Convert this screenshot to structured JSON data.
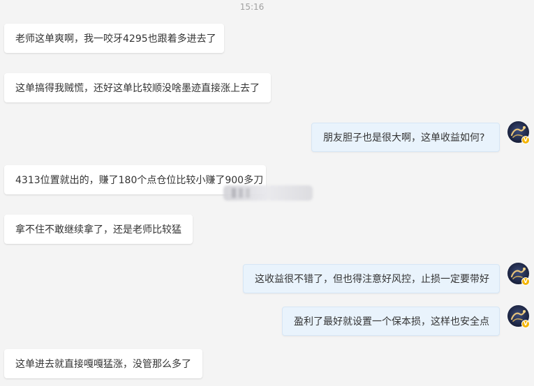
{
  "chat": {
    "timestamp": "15:16",
    "messages": [
      {
        "side": "left",
        "text": "老师这单爽啊，我一咬牙4295也跟着多进去了"
      },
      {
        "side": "left",
        "text": "这单搞得我贼慌，还好这单比较顺没啥墨迹直接涨上去了"
      },
      {
        "side": "right",
        "text": "朋友胆子也是很大啊，这单收益如何?"
      },
      {
        "side": "left",
        "text": "4313位置就出的，赚了180个点仓位比较小赚了900多刀"
      },
      {
        "side": "left",
        "text": "拿不住不敢继续拿了，还是老师比较猛"
      },
      {
        "side": "right",
        "text": "这收益很不错了，但也得注意好风控，止损一定要带好"
      },
      {
        "side": "right",
        "text": "盈利了最好就设置一个保本损，这样也安全点"
      },
      {
        "side": "left",
        "text": "这单进去就直接嘎嘎猛涨，没管那么多了"
      }
    ],
    "avatar_badge": "V",
    "avatar_icon": "dragon-avatar-icon",
    "colors": {
      "background": "#f4f4f4",
      "left_bubble": "#ffffff",
      "right_bubble": "#e9f3fc",
      "badge": "#f4b400"
    }
  }
}
